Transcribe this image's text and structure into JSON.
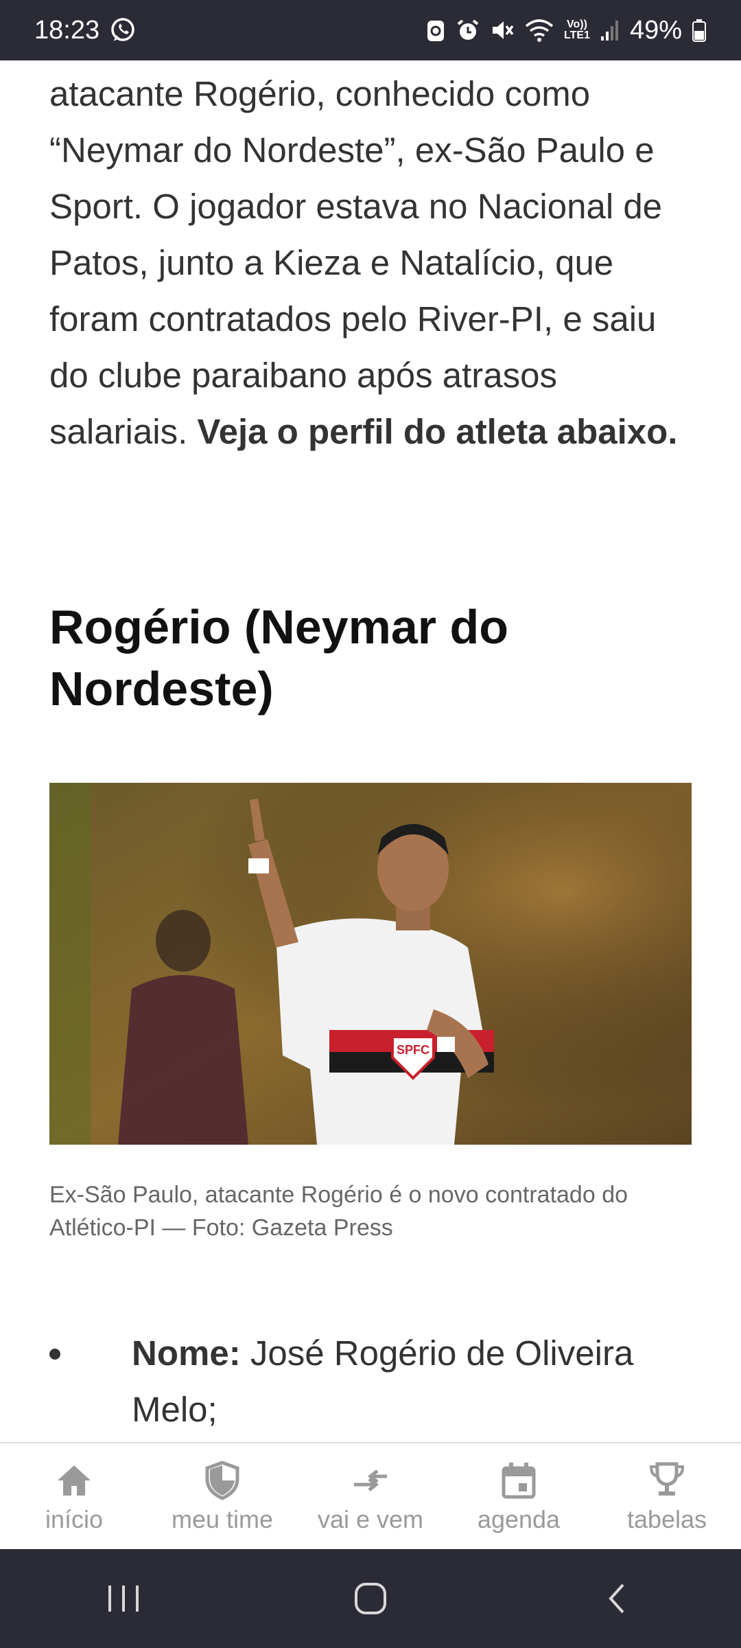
{
  "status_bar": {
    "time": "18:23",
    "volte": "Vo))",
    "lte": "LTE1",
    "battery": "49%",
    "icons": [
      "whatsapp-icon",
      "data-saver-icon",
      "alarm-icon",
      "mute-icon",
      "wifi-icon",
      "signal-icon",
      "battery-icon"
    ]
  },
  "article": {
    "lead_text": "atacante Rogério, conhecido como “Neymar do Nordeste”, ex-São Paulo e Sport. O jogador estava no Nacional de Patos, junto a Kieza e Natalício, que foram contratados pelo River-PI, e saiu do clube paraibano após atrasos salariais. ",
    "lead_bold": "Veja o perfil do atleta abaixo.",
    "heading": "Rogério (Neymar do Nordeste)",
    "photo_badge": "SPFC",
    "photo_caption": "Ex-São Paulo, atacante Rogério é o novo contratado do Atlético-PI — Foto: Gazeta Press",
    "bullets": [
      {
        "label": "Nome:",
        "value": " José Rogério de Oliveira Melo;"
      }
    ]
  },
  "bottom_nav": {
    "items": [
      {
        "label": "início",
        "icon": "home-icon"
      },
      {
        "label": "meu time",
        "icon": "shield-icon"
      },
      {
        "label": "vai e vem",
        "icon": "transfer-arrows-icon"
      },
      {
        "label": "agenda",
        "icon": "calendar-icon"
      },
      {
        "label": "tabelas",
        "icon": "trophy-icon"
      }
    ]
  },
  "system_nav": [
    "recents-icon",
    "home-circle-icon",
    "back-icon"
  ],
  "colors": {
    "status_bar_bg": "#2b2b36",
    "text": "#333333",
    "caption": "#666666",
    "nav_inactive": "#9a9a9a"
  }
}
